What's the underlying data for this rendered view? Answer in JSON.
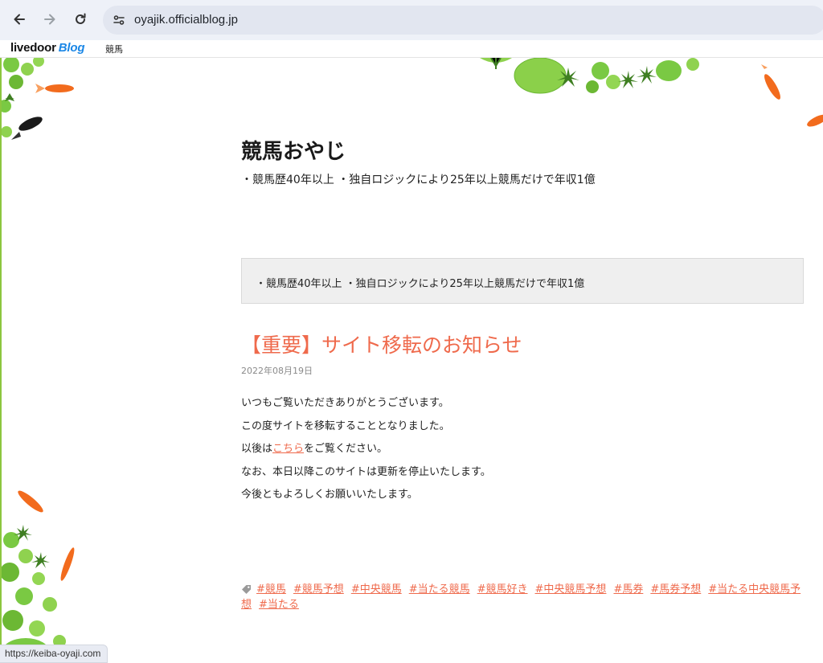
{
  "browser": {
    "url": "oyajik.officialblog.jp",
    "status_url": "https://keiba-oyaji.com"
  },
  "livedoor_bar": {
    "logo_main": "livedoor",
    "logo_sub": "Blog",
    "category": "競馬"
  },
  "blog": {
    "title": "競馬おやじ",
    "description": "・競馬歴40年以上 ・独自ロジックにより25年以上競馬だけで年収1億",
    "description_box": "・競馬歴40年以上 ・独自ロジックにより25年以上競馬だけで年収1億"
  },
  "post": {
    "title": "【重要】サイト移転のお知らせ",
    "date": "2022年08月19日",
    "line1": "いつもご覧いただきありがとうございます。",
    "line2": "この度サイトを移転することとなりました。",
    "line3_before": "以後は",
    "line3_link": "こちら",
    "line3_after": "をご覧ください。",
    "line4": "なお、本日以降このサイトは更新を停止いたします。",
    "line5": "今後ともよろしくお願いいたします。",
    "tags": [
      "#競馬",
      "#競馬予想",
      "#中央競馬",
      "#当たる競馬",
      "#競馬好き",
      "#中央競馬予想",
      "#馬券",
      "#馬券予想",
      "#当たる中央競馬予想",
      "#当たる"
    ]
  },
  "colors": {
    "accent": "#ef6a4c",
    "leaf_green": "#7ac943",
    "border_green": "#8cc63f",
    "goldfish": "#f26b1d"
  },
  "icons": [
    "back-arrow-icon",
    "forward-arrow-icon",
    "reload-icon",
    "site-info-icon",
    "tag-icon",
    "goldfish-icon",
    "leaf-icon"
  ]
}
